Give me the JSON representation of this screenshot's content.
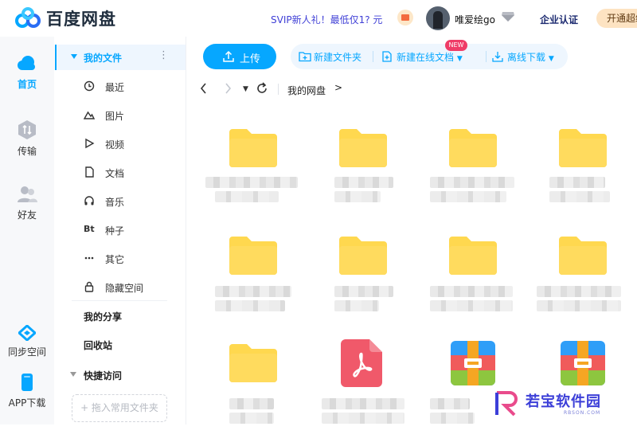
{
  "app": {
    "title": "百度网盘"
  },
  "header": {
    "promo": "SVIP新人礼！最低仅1? 元",
    "username": "唯爱绘go",
    "enterprise": "企业认证",
    "open_vip": "开通超级"
  },
  "rail": {
    "items": [
      {
        "label": "首页",
        "icon": "cloud-icon",
        "active": true
      },
      {
        "label": "传输",
        "icon": "transfer-icon"
      },
      {
        "label": "好友",
        "icon": "friends-icon"
      },
      {
        "label": "同步空间",
        "icon": "sync-space-icon"
      },
      {
        "label": "APP下载",
        "icon": "phone-icon"
      }
    ]
  },
  "sidebar": {
    "my_files": "我的文件",
    "items": [
      {
        "label": "最近",
        "icon": "clock-icon"
      },
      {
        "label": "图片",
        "icon": "mountain-icon"
      },
      {
        "label": "视频",
        "icon": "play-icon"
      },
      {
        "label": "文档",
        "icon": "document-icon"
      },
      {
        "label": "音乐",
        "icon": "headphones-icon"
      },
      {
        "label": "种子",
        "icon": "bt-icon"
      },
      {
        "label": "其它",
        "icon": "ellipsis-icon"
      },
      {
        "label": "隐藏空间",
        "icon": "lock-icon"
      }
    ],
    "my_share": "我的分享",
    "recycle": "回收站",
    "quick_access": "快捷访问",
    "drop_hint": "+ 拖入常用文件夹"
  },
  "toolbar": {
    "upload": "上传",
    "new_folder": "新建文件夹",
    "new_online_doc": "新建在线文档",
    "new_badge": "NEW",
    "offline_download": "离线下载"
  },
  "nav": {
    "breadcrumb": "我的网盘",
    "arrow": ">",
    "bt_icon_text": "Bt"
  },
  "files": [
    {
      "type": "folder"
    },
    {
      "type": "folder"
    },
    {
      "type": "folder"
    },
    {
      "type": "folder"
    },
    {
      "type": "folder"
    },
    {
      "type": "folder"
    },
    {
      "type": "folder"
    },
    {
      "type": "folder"
    },
    {
      "type": "folder"
    },
    {
      "type": "pdf"
    },
    {
      "type": "archive"
    },
    {
      "type": "archive"
    }
  ],
  "watermark": {
    "title": "若宝软件园",
    "sub": "RBSON.COM"
  },
  "colors": {
    "accent": "#06a7ff",
    "folder": "#ffd84f",
    "pdf": "#f0596a"
  }
}
